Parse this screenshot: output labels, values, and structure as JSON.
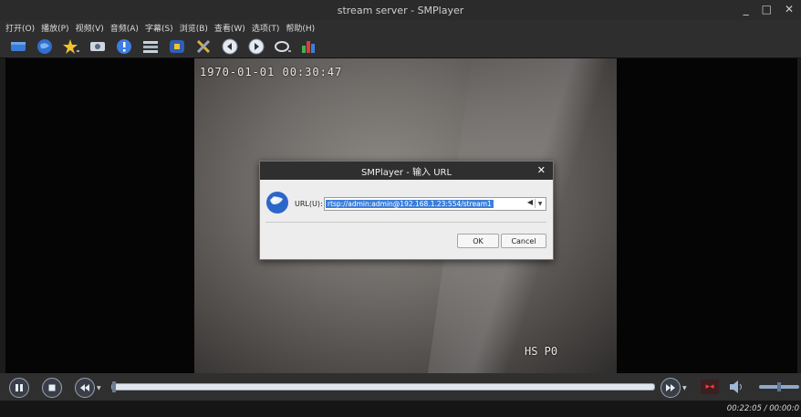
{
  "window": {
    "title": "stream server - SMPlayer",
    "minimize": "_",
    "maximize": "□",
    "close": "✕"
  },
  "menu": [
    "打开(O)",
    "播放(P)",
    "视频(V)",
    "音频(A)",
    "字幕(S)",
    "浏览(B)",
    "查看(W)",
    "选项(T)",
    "帮助(H)"
  ],
  "toolbar_icons": [
    "open-file-icon",
    "open-url-icon",
    "favorites-icon",
    "screenshot-icon",
    "info-icon",
    "playlist-icon",
    "compact-icon",
    "preferences-icon",
    "previous-icon",
    "next-icon",
    "subtitle-icon",
    "equalizer-icon"
  ],
  "video": {
    "osd_timestamp": "1970-01-01 00:30:47",
    "osd_camera_label": "HS P0"
  },
  "dialog": {
    "title": "SMPlayer - 输入 URL",
    "url_label": "URL(U):",
    "url_value": "rtsp://admin:admin@192.168.1.23:554/stream1",
    "ok_label": "OK",
    "cancel_label": "Cancel"
  },
  "controls": {
    "seek_progress": 0.0,
    "volume_level": 0.5
  },
  "status": {
    "time": "00:22:05 / 00:00:0"
  }
}
